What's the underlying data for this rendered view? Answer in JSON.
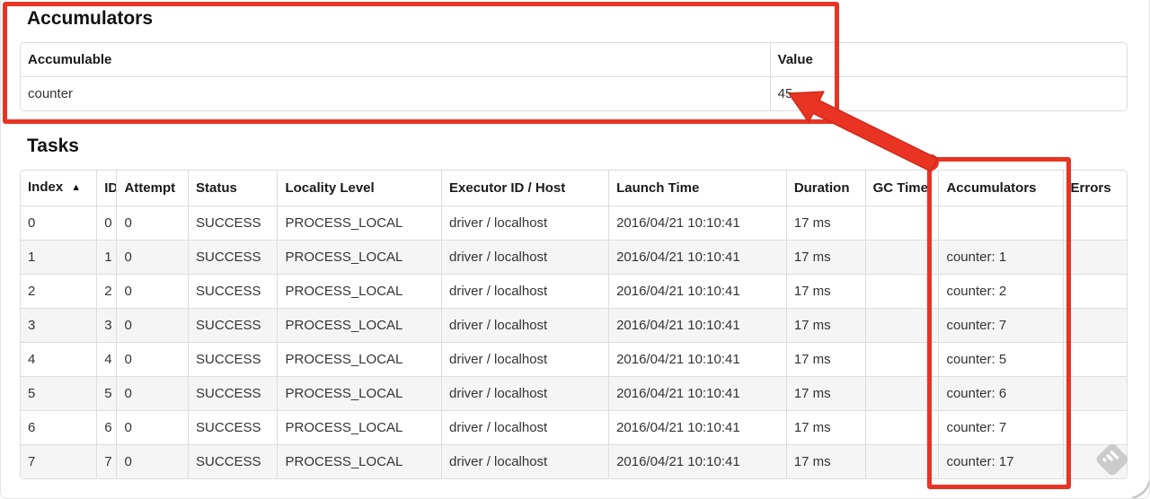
{
  "accumulators_section": {
    "title": "Accumulators",
    "table": {
      "headers": [
        "Accumulable",
        "Value"
      ],
      "rows": [
        {
          "accumulable": "counter",
          "value": "45"
        }
      ]
    }
  },
  "tasks_section": {
    "title": "Tasks",
    "table": {
      "sort_icon": "▲",
      "headers": [
        "Index",
        "ID",
        "Attempt",
        "Status",
        "Locality Level",
        "Executor ID / Host",
        "Launch Time",
        "Duration",
        "GC Time",
        "Accumulators",
        "Errors"
      ],
      "rows": [
        {
          "index": "0",
          "id": "0",
          "attempt": "0",
          "status": "SUCCESS",
          "locality_level": "PROCESS_LOCAL",
          "executor_id_host": "driver / localhost",
          "launch_time": "2016/04/21 10:10:41",
          "duration": "17 ms",
          "gc_time": "",
          "accumulators": "",
          "errors": ""
        },
        {
          "index": "1",
          "id": "1",
          "attempt": "0",
          "status": "SUCCESS",
          "locality_level": "PROCESS_LOCAL",
          "executor_id_host": "driver / localhost",
          "launch_time": "2016/04/21 10:10:41",
          "duration": "17 ms",
          "gc_time": "",
          "accumulators": "counter: 1",
          "errors": ""
        },
        {
          "index": "2",
          "id": "2",
          "attempt": "0",
          "status": "SUCCESS",
          "locality_level": "PROCESS_LOCAL",
          "executor_id_host": "driver / localhost",
          "launch_time": "2016/04/21 10:10:41",
          "duration": "17 ms",
          "gc_time": "",
          "accumulators": "counter: 2",
          "errors": ""
        },
        {
          "index": "3",
          "id": "3",
          "attempt": "0",
          "status": "SUCCESS",
          "locality_level": "PROCESS_LOCAL",
          "executor_id_host": "driver / localhost",
          "launch_time": "2016/04/21 10:10:41",
          "duration": "17 ms",
          "gc_time": "",
          "accumulators": "counter: 7",
          "errors": ""
        },
        {
          "index": "4",
          "id": "4",
          "attempt": "0",
          "status": "SUCCESS",
          "locality_level": "PROCESS_LOCAL",
          "executor_id_host": "driver / localhost",
          "launch_time": "2016/04/21 10:10:41",
          "duration": "17 ms",
          "gc_time": "",
          "accumulators": "counter: 5",
          "errors": ""
        },
        {
          "index": "5",
          "id": "5",
          "attempt": "0",
          "status": "SUCCESS",
          "locality_level": "PROCESS_LOCAL",
          "executor_id_host": "driver / localhost",
          "launch_time": "2016/04/21 10:10:41",
          "duration": "17 ms",
          "gc_time": "",
          "accumulators": "counter: 6",
          "errors": ""
        },
        {
          "index": "6",
          "id": "6",
          "attempt": "0",
          "status": "SUCCESS",
          "locality_level": "PROCESS_LOCAL",
          "executor_id_host": "driver / localhost",
          "launch_time": "2016/04/21 10:10:41",
          "duration": "17 ms",
          "gc_time": "",
          "accumulators": "counter: 7",
          "errors": ""
        },
        {
          "index": "7",
          "id": "7",
          "attempt": "0",
          "status": "SUCCESS",
          "locality_level": "PROCESS_LOCAL",
          "executor_id_host": "driver / localhost",
          "launch_time": "2016/04/21 10:10:41",
          "duration": "17 ms",
          "gc_time": "",
          "accumulators": "counter: 17",
          "errors": ""
        }
      ]
    }
  },
  "annotations": {
    "color": "#e93323"
  },
  "icons": {
    "sort_ascending": "sort-ascending-icon",
    "watermark": "annotation-tool-watermark-icon"
  }
}
